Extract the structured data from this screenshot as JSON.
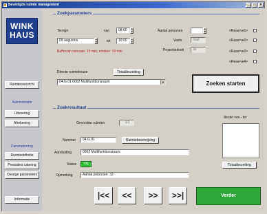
{
  "window": {
    "title": "Beveiligde ruimte management"
  },
  "sidebar": {
    "logo": "WINK HAUS",
    "ruimte_overzicht": "Ruimteoverzicht",
    "administratie_head": "Administratie",
    "uitvoering": "Uitvoering",
    "afrekening": "Afrekening",
    "parametrering_head": "Parametrering",
    "ruimtedefinitie": "Ruimtedefinitie",
    "prestaties_catering": "Prestaties catering",
    "overige_parameters": "Overige parameters",
    "informatie": "Informatie"
  },
  "search": {
    "section_title": "Zoekparameters",
    "termijn_label": "Termijn",
    "date_value": "09 augustus",
    "van_label": "van",
    "van_value": "08:00",
    "tot_label": "tot",
    "tot_value": "16:00",
    "warning": "Bufferzijn vooraan: 15 min; eindien: 15 min",
    "aantal_label": "Aantal personen",
    "aantal_value": "",
    "vaste_label": "Vaste",
    "vaste_value": "Vast",
    "projectie_label": "Projectiedoek",
    "projectie_value": "Ja",
    "reserve1": "<Reserve1>",
    "reserve2": "<Reserve2>",
    "reserve3": "<Reserve3>",
    "reserve4": "<Reserve4>",
    "directe_label": "Directe ruimtekeuze",
    "totaal_btn": "Totaalbezetting",
    "room_select": "04.G.01   0002 Multifunktionsraum",
    "zoeken_btn": "Zoeken starten"
  },
  "result": {
    "section_title": "Zoekresultaat",
    "gevonden_label": "Gevonden ruimten",
    "gevonden_value": "1/1",
    "nummer_label": "Nummer",
    "nummer_value": "04.G.01",
    "ruimtebeschrijving_btn": "Ruimtebeschrijving",
    "aanduiding_label": "Aanduiding",
    "aanduiding_value": "0002 Multifunktionsraum",
    "status_label": "Status",
    "status_value": "Vrij",
    "opmerking_label": "Opmerking",
    "opmerking_value": "Aantal personen: 32",
    "bestel_label": "Bestel van - tot",
    "totaal_btn": "Totaalbezetting"
  },
  "nav": {
    "first": "|<<",
    "prev": "<<",
    "next": ">>",
    "last": ">>|",
    "verder": "Verder"
  },
  "colors": {
    "accent": "#1e3f8e",
    "status_free": "#2fbf38",
    "verder": "#2ea83a",
    "warning": "#b02020"
  }
}
